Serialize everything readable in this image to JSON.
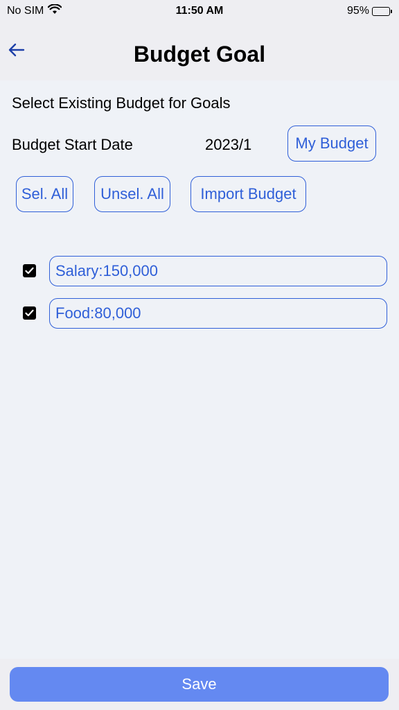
{
  "status_bar": {
    "carrier": "No SIM",
    "wifi_icon": "wifi-icon",
    "time": "11:50 AM",
    "battery_text": "95%",
    "battery_level": 0.95,
    "battery_icon": "battery-icon"
  },
  "nav": {
    "back_icon": "back-arrow-icon",
    "title": "Budget Goal"
  },
  "content": {
    "section_title": "Select Existing Budget for Goals",
    "start_date_label": "Budget Start Date",
    "start_date_value": "2023/1",
    "my_budget_label": "My Budget",
    "select_all_label": "Sel. All",
    "unselect_all_label": "Unsel. All",
    "import_budget_label": "Import Budget",
    "items": [
      {
        "label": "Salary:150,000",
        "checked": true
      },
      {
        "label": "Food:80,000",
        "checked": true
      }
    ]
  },
  "footer": {
    "save_label": "Save"
  },
  "colors": {
    "accent": "#2f5fd8",
    "save_button": "#6489f1",
    "nav_background": "#eeeef2",
    "content_background": "#eff2f7"
  }
}
